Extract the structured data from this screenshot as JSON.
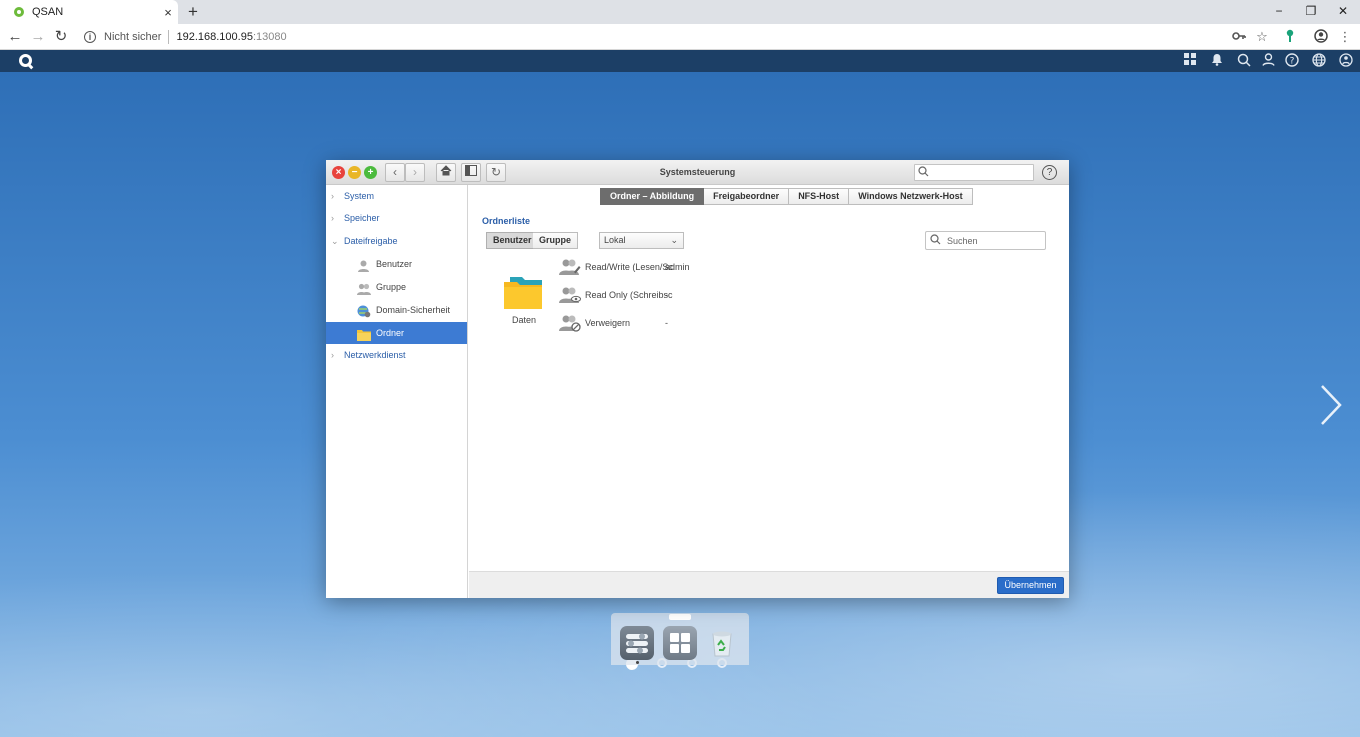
{
  "browser": {
    "tab_title": "QSAN",
    "tab_close": "×",
    "new_tab": "+",
    "security_label": "Nicht sicher",
    "url_host": "192.168.100.95",
    "url_port": ":13080",
    "minimize": "−",
    "restore": "❐",
    "close": "✕"
  },
  "window": {
    "title": "Systemsteuerung"
  },
  "sidebar": {
    "items": [
      {
        "label": "System"
      },
      {
        "label": "Speicher"
      },
      {
        "label": "Dateifreigabe"
      },
      {
        "label": "Benutzer"
      },
      {
        "label": "Gruppe"
      },
      {
        "label": "Domain-Sicherheit"
      },
      {
        "label": "Ordner"
      },
      {
        "label": "Netzwerkdienst"
      }
    ],
    "selected": "Ordner"
  },
  "tabs": [
    {
      "label": "Ordner – Abbildung"
    },
    {
      "label": "Freigabeordner"
    },
    {
      "label": "NFS-Host"
    },
    {
      "label": "Windows Netzwerk-Host"
    }
  ],
  "content": {
    "heading": "Ordnerliste",
    "toggle_user": "Benutzer",
    "toggle_group": "Gruppe",
    "select_value": "Lokal",
    "search_placeholder": "Suchen",
    "folder_name": "Daten",
    "permissions": [
      {
        "label": "Read/Write (Lesen/Sc",
        "value": "admin"
      },
      {
        "label": "Read Only (Schreibsc",
        "value": "-"
      },
      {
        "label": "Verweigern",
        "value": "-"
      }
    ]
  },
  "footer": {
    "apply_label": "Übernehmen"
  },
  "colors": {
    "accent": "#2a6dc9",
    "sidebar_selected": "#3d7bd3",
    "nas_bar": "#1c3f66",
    "section_text": "#2b5ea8"
  }
}
